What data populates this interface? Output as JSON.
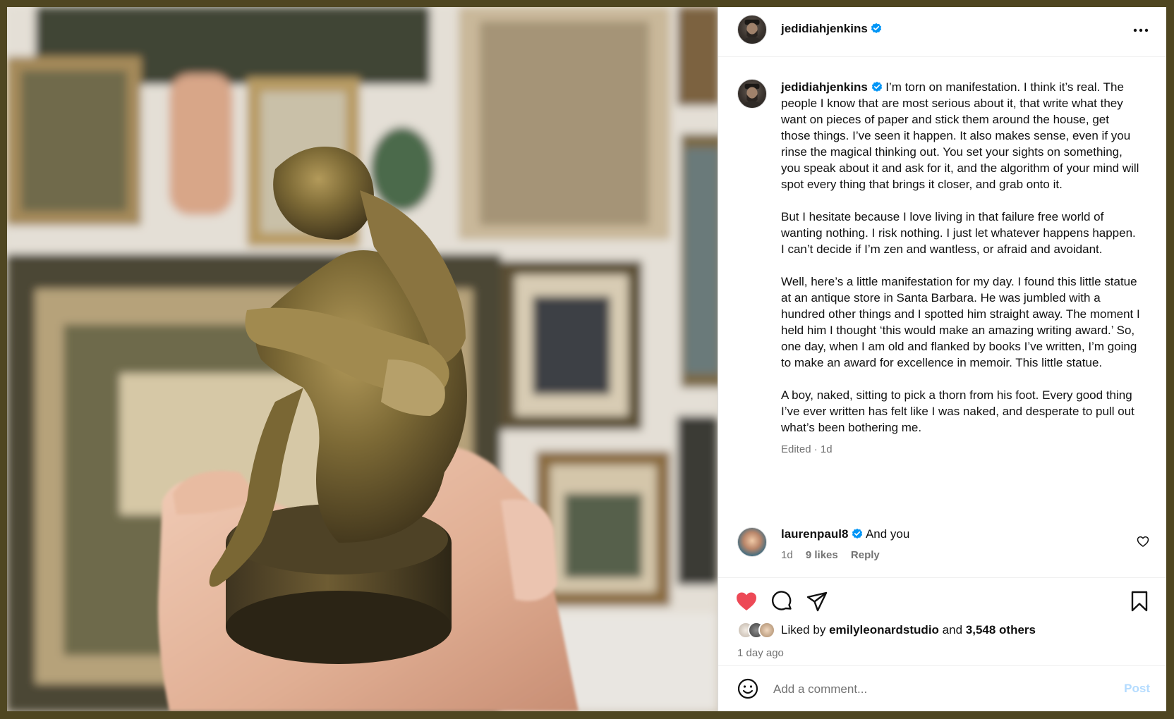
{
  "post": {
    "author": "jedidiahjenkins",
    "caption_paragraphs": [
      "I’m torn on manifestation. I think it’s real. The people I know that are most serious about it, that write what they want on pieces of paper and stick them around the house, get those things. I’ve seen it happen. It also makes sense, even if you rinse the magical thinking out. You set your sights on something, you speak about it and ask for it, and the algorithm of your mind will spot every thing that brings it closer, and grab onto it.",
      "But I hesitate because I love living in that failure free world of wanting nothing. I risk nothing. I just let whatever happens happen. I can’t decide if I’m zen and wantless, or afraid and avoidant.",
      "Well, here’s a little manifestation for my day. I found this little statue at an antique store in Santa Barbara. He was jumbled with a hundred other things and I spotted him straight away. The moment I held him I thought ‘this would make an amazing writing award.’ So, one day, when I am old and flanked by books I’ve written, I’m going to make an award for excellence in memoir. This little statue.",
      "A boy, naked, sitting to pick a thorn from his foot. Every good thing I’ve ever written has felt like I was naked, and desperate to pull out what’s been bothering me."
    ],
    "edited_label": "Edited · 1d"
  },
  "comment": {
    "username": "laurenpaul8",
    "text": "And you",
    "age": "1d",
    "likes": "9 likes",
    "reply": "Reply"
  },
  "likes": {
    "prefix": "Liked by",
    "user": "emilyleonardstudio",
    "joiner": "and",
    "others": "3,548 others"
  },
  "time_ago": "1 day ago",
  "composer": {
    "placeholder": "Add a comment...",
    "post_label": "Post"
  },
  "colors": {
    "heart": "#ed4956",
    "verified": "#0095f6",
    "post_disabled": "#b3dbff",
    "frame": "#4f4621"
  },
  "icons": [
    "more-icon",
    "verified-icon",
    "heart-icon",
    "comment-icon",
    "share-icon",
    "bookmark-icon",
    "emoji-icon",
    "heart-outline-icon"
  ]
}
